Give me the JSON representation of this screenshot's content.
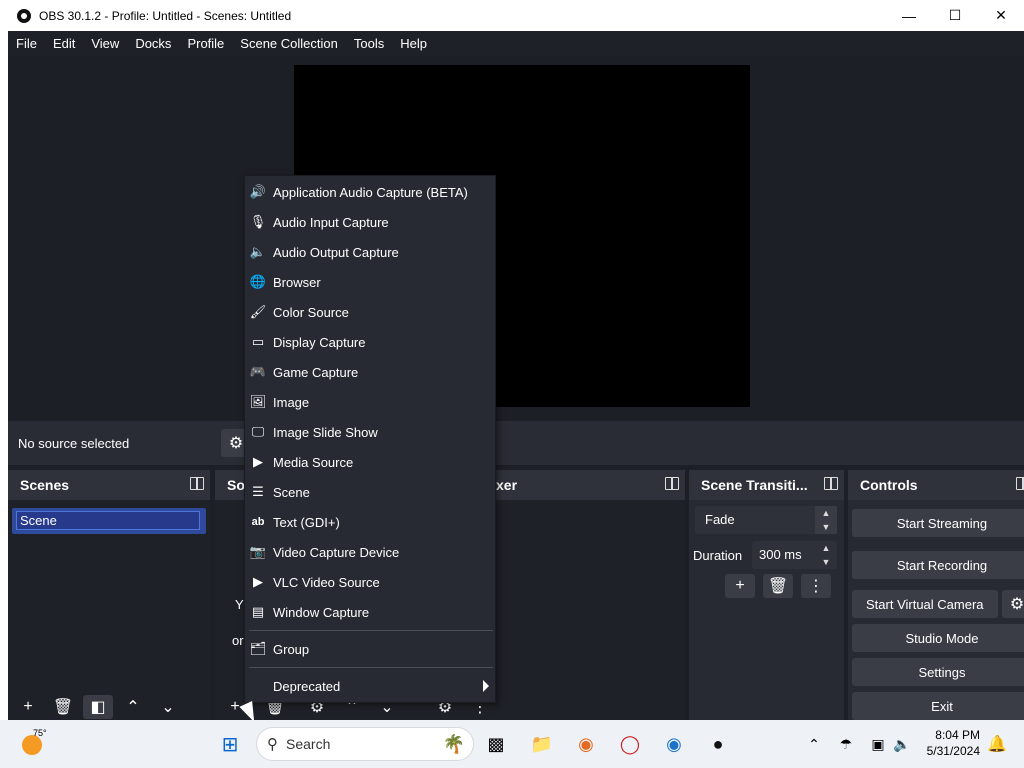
{
  "window": {
    "title": "OBS 30.1.2 - Profile: Untitled - Scenes: Untitled"
  },
  "menubar": [
    "File",
    "Edit",
    "View",
    "Docks",
    "Profile",
    "Scene Collection",
    "Tools",
    "Help"
  ],
  "context_bar": {
    "no_source": "No source selected"
  },
  "docks": {
    "scenes": {
      "title": "Scenes",
      "items": [
        "Scene"
      ]
    },
    "sources": {
      "title_prefix": "So",
      "partial_text_1": "Y",
      "partial_text_2": "or"
    },
    "mixer": {
      "title_suffix": "xer"
    },
    "transitions": {
      "title": "Scene Transiti...",
      "selected": "Fade",
      "duration_label": "Duration",
      "duration_value": "300 ms"
    },
    "controls": {
      "title": "Controls",
      "buttons": [
        "Start Streaming",
        "Start Recording",
        "Start Virtual Camera",
        "Studio Mode",
        "Settings",
        "Exit"
      ]
    }
  },
  "context_menu": {
    "items": [
      {
        "label": "Application Audio Capture (BETA)",
        "icon": "speaker-box-icon"
      },
      {
        "label": "Audio Input Capture",
        "icon": "microphone-icon"
      },
      {
        "label": "Audio Output Capture",
        "icon": "speaker-icon"
      },
      {
        "label": "Browser",
        "icon": "globe-icon"
      },
      {
        "label": "Color Source",
        "icon": "brush-icon"
      },
      {
        "label": "Display Capture",
        "icon": "monitor-icon"
      },
      {
        "label": "Game Capture",
        "icon": "gamepad-icon"
      },
      {
        "label": "Image",
        "icon": "image-icon"
      },
      {
        "label": "Image Slide Show",
        "icon": "slideshow-icon"
      },
      {
        "label": "Media Source",
        "icon": "play-icon"
      },
      {
        "label": "Scene",
        "icon": "list-icon"
      },
      {
        "label": "Text (GDI+)",
        "icon": "text-icon"
      },
      {
        "label": "Video Capture Device",
        "icon": "camera-icon"
      },
      {
        "label": "VLC Video Source",
        "icon": "play-icon"
      },
      {
        "label": "Window Capture",
        "icon": "window-icon"
      }
    ],
    "group": "Group",
    "deprecated": "Deprecated"
  },
  "taskbar": {
    "weather_temp": "75°",
    "search_placeholder": "Search",
    "time": "8:04 PM",
    "date": "5/31/2024"
  },
  "colors": {
    "accent": "#304a9b",
    "panel": "#272a33",
    "background": "#1d1f26"
  }
}
